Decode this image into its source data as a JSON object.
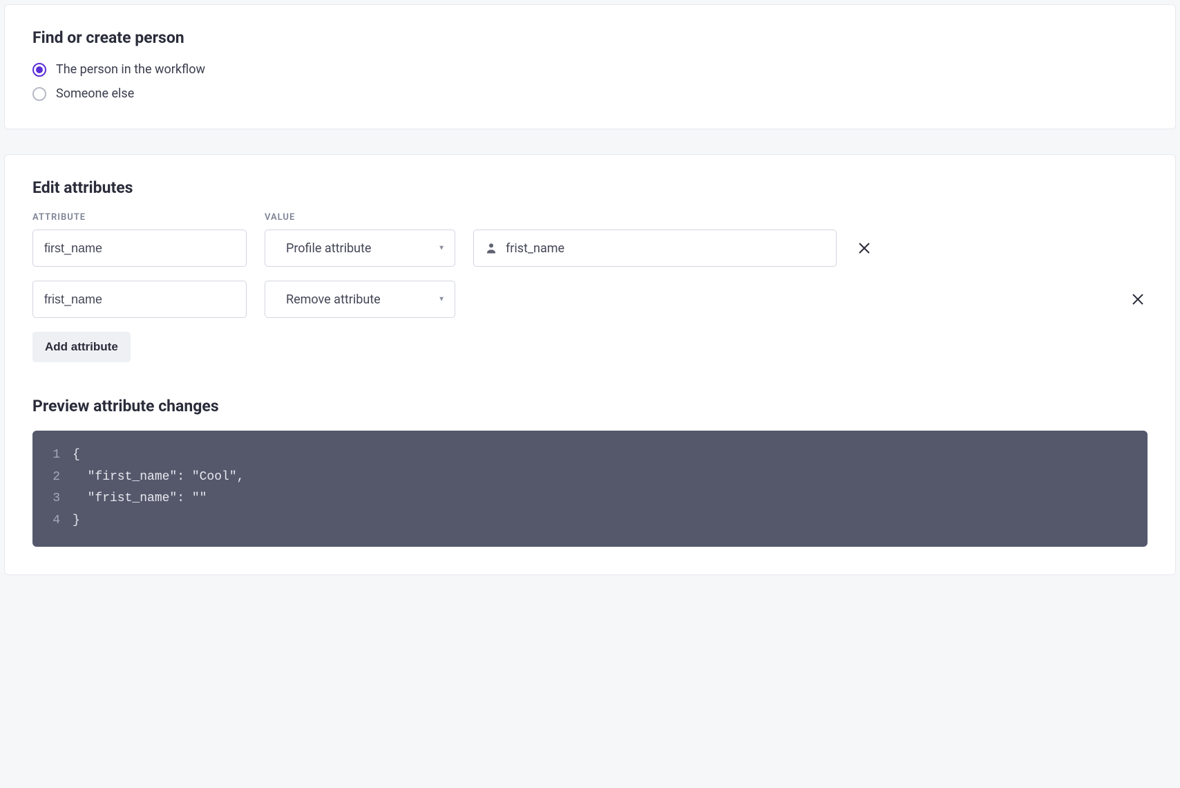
{
  "find_section": {
    "title": "Find or create person",
    "options": [
      {
        "label": "The person in the workflow",
        "selected": true
      },
      {
        "label": "Someone else",
        "selected": false
      }
    ]
  },
  "edit_section": {
    "title": "Edit attributes",
    "headers": {
      "attribute": "ATTRIBUTE",
      "value": "VALUE"
    },
    "rows": [
      {
        "attribute": "first_name",
        "action": "Profile attribute",
        "value_label": "frist_name",
        "show_value_field": true
      },
      {
        "attribute": "frist_name",
        "action": "Remove attribute",
        "value_label": "",
        "show_value_field": false
      }
    ],
    "add_button": "Add attribute"
  },
  "preview_section": {
    "title": "Preview attribute changes",
    "lines": [
      {
        "num": "1",
        "text": "{"
      },
      {
        "num": "2",
        "text": "  \"first_name\": \"Cool\","
      },
      {
        "num": "3",
        "text": "  \"frist_name\": \"\""
      },
      {
        "num": "4",
        "text": "}"
      }
    ],
    "object": {
      "first_name": "Cool",
      "frist_name": ""
    }
  },
  "colors": {
    "accent": "#5b2dd6",
    "code_bg": "#55586b"
  }
}
